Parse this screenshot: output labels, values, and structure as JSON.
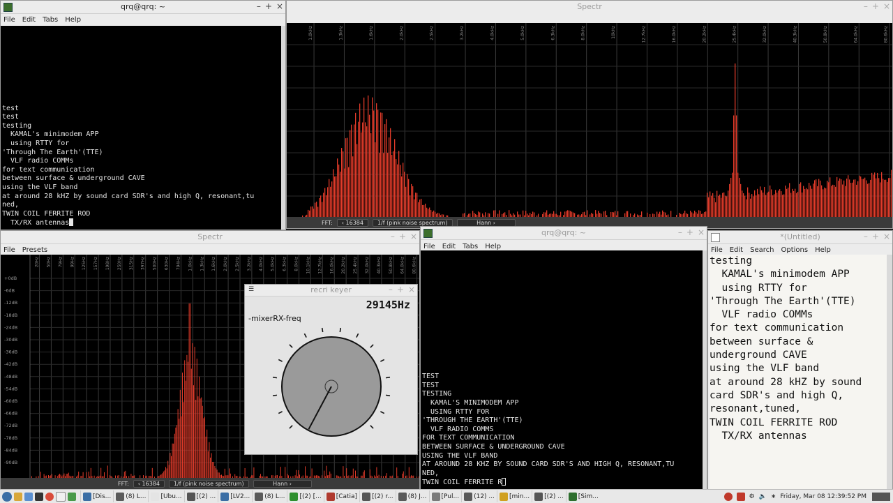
{
  "colors": {
    "spectrum_bar": "#e23b2a",
    "terminal_bg": "#000000",
    "terminal_fg": "#e6e6e6",
    "editor_bg": "#f6f5f1"
  },
  "term1": {
    "title": "qrq@qrq: ~",
    "menu": [
      "File",
      "Edit",
      "Tabs",
      "Help"
    ],
    "text": "test\ntest\ntesting\n  KAMAL's minimodem APP\n  using RTTY for\n'Through The Earth'(TTE)\n  VLF radio COMMs\nfor text communication\nbetween surface & underground CAVE\nusing the VLF band\nat around 28 kHZ by sound card SDR's and high Q, resonant,tu\nned,\nTWIN COIL FERRITE ROD\n  TX/RX antennas"
  },
  "spectr_top": {
    "title": "Spectr",
    "freq_labels": [
      "1.0kHz",
      "1.3kHz",
      "1.6kHz",
      "2.0kHz",
      "2.5kHz",
      "3.2kHz",
      "4.0kHz",
      "5.0kHz",
      "6.3kHz",
      "8.0kHz",
      "10kHz",
      "12.7kHz",
      "16.0kHz",
      "20.2kHz",
      "25.4kHz",
      "32.0kHz",
      "40.3kHz",
      "50.8kHz",
      "64.0kHz",
      "80.6kHz"
    ],
    "fft_label": "FFT:",
    "fft_value": "16384",
    "noise_mode": "1/f (pink noise spectrum)",
    "window": "Hann"
  },
  "spectr_bottom": {
    "title": "Spectr",
    "menu": [
      "File",
      "Presets"
    ],
    "freq_labels": [
      "20Hz",
      "50Hz",
      "79Hz",
      "99Hz",
      "125Hz",
      "157Hz",
      "198Hz",
      "250Hz",
      "315Hz",
      "397Hz",
      "500Hz",
      "630Hz",
      "794Hz",
      "1.0kHz",
      "1.3kHz",
      "1.6kHz",
      "2.0kHz",
      "2.5kHz",
      "3.2kHz",
      "4.0kHz",
      "5.0kHz",
      "6.3kHz",
      "8.0kHz",
      "10.1kHz",
      "12.7kHz",
      "16.0kHz",
      "20.2kHz",
      "25.4kHz",
      "32.0kHz",
      "40.3kHz",
      "50.8kHz",
      "64.0kHz",
      "80.6kHz"
    ],
    "db_labels": [
      "+0dB",
      "-6dB",
      "-12dB",
      "-18dB",
      "-24dB",
      "-30dB",
      "-36dB",
      "-42dB",
      "-48dB",
      "-54dB",
      "-60dB",
      "-66dB",
      "-72dB",
      "-78dB",
      "-84dB",
      "-90dB"
    ],
    "fft_label": "FFT:",
    "fft_value": "16384",
    "noise_mode": "1/f (pink noise spectrum)",
    "window": "Hann"
  },
  "keyer": {
    "title": "recri keyer",
    "freq_readout": "29145Hz",
    "knob_label": "-mixerRX-freq"
  },
  "term2": {
    "title": "qrq@qrq: ~",
    "menu": [
      "File",
      "Edit",
      "Tabs",
      "Help"
    ],
    "text": "TEST\nTEST\nTESTING\n  KAMAL'S MINIMODEM APP\n  USING RTTY FOR\n'THROUGH THE EARTH'(TTE)\n  VLF RADIO COMMS\nFOR TEXT COMMUNICATION\nBETWEEN SURFACE & UNDERGROUND CAVE\nUSING THE VLF BAND\nAT AROUND 28 KHZ BY SOUND CARD SDR'S AND HIGH Q, RESONANT,TU\nNED,\nTWIN COIL FERRITE R"
  },
  "editor": {
    "title": "*(Untitled)",
    "menu": [
      "File",
      "Edit",
      "Search",
      "Options",
      "Help"
    ],
    "text": "testing\n  KAMAL's minimodem APP\n  using RTTY for\n'Through The Earth'(TTE)\n  VLF radio COMMs\nfor text communication\nbetween surface &\nunderground CAVE\nusing the VLF band\nat around 28 kHZ by sound\ncard SDR's and high Q,\nresonant,tuned,\nTWIN COIL FERRITE ROD\n  TX/RX antennas"
  },
  "taskbar": {
    "tasks": [
      {
        "label": "[Dis...",
        "icon_color": "#3b6ea5"
      },
      {
        "label": "(8) L...",
        "icon_color": "#5a5a5a"
      },
      {
        "label": "[Ubu...",
        "icon_color": "#e4e4e4"
      },
      {
        "label": "[(2) ...",
        "icon_color": "#555555"
      },
      {
        "label": "[LV2...",
        "icon_color": "#3b6ea5"
      },
      {
        "label": "(8) L...",
        "icon_color": "#5a5a5a"
      },
      {
        "label": "[(2) [...",
        "icon_color": "#2f8f2f"
      },
      {
        "label": "[Catia]",
        "icon_color": "#b03a2e"
      },
      {
        "label": "[(2) r...",
        "icon_color": "#555555"
      },
      {
        "label": "(8) J...",
        "icon_color": "#5a5a5a"
      },
      {
        "label": "[Pul...",
        "icon_color": "#7a7a7a"
      },
      {
        "label": "(12) ...",
        "icon_color": "#5a5a5a"
      },
      {
        "label": "[min...",
        "icon_color": "#d0a020"
      },
      {
        "label": "[(2) ...",
        "icon_color": "#555555"
      },
      {
        "label": "[Sim...",
        "icon_color": "#2f6f2f"
      }
    ],
    "clock": "Friday, Mar 08 12:39:52 PM"
  }
}
